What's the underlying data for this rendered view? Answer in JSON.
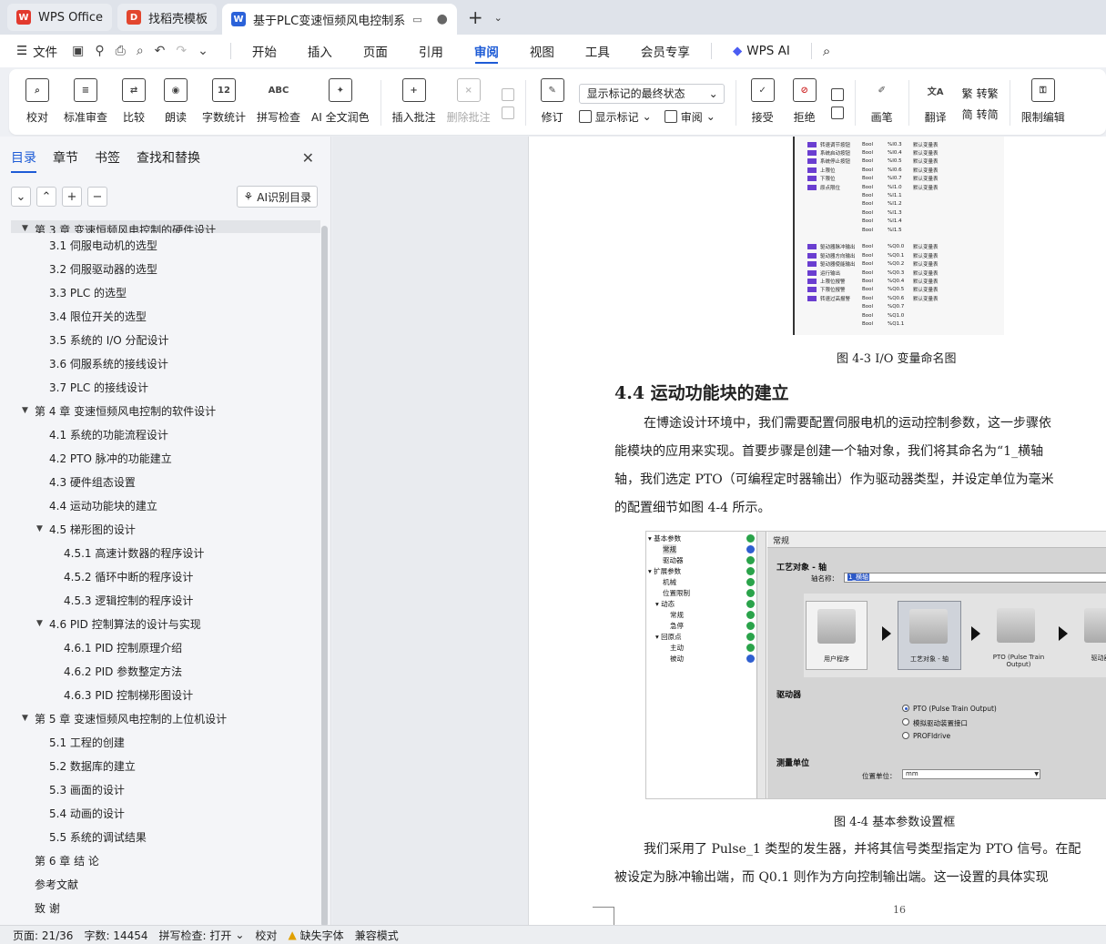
{
  "tabs": [
    {
      "label": "WPS Office",
      "icon": "wps-logo-icon"
    },
    {
      "label": "找稻壳模板",
      "icon": "daoke-logo-icon"
    },
    {
      "label": "基于PLC变速恒频风电控制系",
      "icon": "writer-logo-icon"
    }
  ],
  "menu": {
    "file": "文件",
    "items": [
      "开始",
      "插入",
      "页面",
      "引用",
      "审阅",
      "视图",
      "工具",
      "会员专享"
    ],
    "active": "审阅",
    "wps_ai": "WPS AI"
  },
  "ribbon": {
    "proofread": "校对",
    "standard_review": "标准审查",
    "compare": "比较",
    "read_aloud": "朗读",
    "word_count": "字数统计",
    "spell_check": "拼写检查",
    "ai_polish": "AI 全文润色",
    "insert_comment": "插入批注",
    "delete_comment": "删除批注",
    "track_changes": "修订",
    "markup_select": "显示标记的最终状态",
    "show_markup": "显示标记",
    "review_pane": "审阅",
    "accept": "接受",
    "reject": "拒绝",
    "pen": "画笔",
    "translate": "翻译",
    "to_traditional": "转繁",
    "to_simplified": "转简",
    "restrict_edit": "限制编辑"
  },
  "left_panel": {
    "tabs": [
      "目录",
      "章节",
      "书签",
      "查找和替换"
    ],
    "active_tab": "目录",
    "ai_toc": "AI识别目录",
    "toc": [
      {
        "text": "第 3 章  变速恒频风电控制的硬件设计",
        "level": 1,
        "arrow": "▼",
        "cut": true
      },
      {
        "text": "3.1  伺服电动机的选型",
        "level": 2
      },
      {
        "text": "3.2  伺服驱动器的选型",
        "level": 2
      },
      {
        "text": "3.3 PLC 的选型",
        "level": 2
      },
      {
        "text": "3.4  限位开关的选型",
        "level": 2
      },
      {
        "text": "3.5  系统的 I/O 分配设计",
        "level": 2
      },
      {
        "text": "3.6  伺服系统的接线设计",
        "level": 2
      },
      {
        "text": "3.7 PLC 的接线设计",
        "level": 2
      },
      {
        "text": "第 4 章  变速恒频风电控制的软件设计",
        "level": 1,
        "arrow": "▼"
      },
      {
        "text": "4.1  系统的功能流程设计",
        "level": 2
      },
      {
        "text": "4.2 PTO 脉冲的功能建立",
        "level": 2
      },
      {
        "text": "4.3  硬件组态设置",
        "level": 2
      },
      {
        "text": "4.4  运动功能块的建立",
        "level": 2
      },
      {
        "text": "4.5  梯形图的设计",
        "level": 2,
        "arrow": "▼"
      },
      {
        "text": "4.5.1  高速计数器的程序设计",
        "level": 3
      },
      {
        "text": "4.5.2  循环中断的程序设计",
        "level": 3
      },
      {
        "text": "4.5.3  逻辑控制的程序设计",
        "level": 3
      },
      {
        "text": "4.6 PID 控制算法的设计与实现",
        "level": 2,
        "arrow": "▼"
      },
      {
        "text": "4.6.1 PID 控制原理介绍",
        "level": 3
      },
      {
        "text": "4.6.2 PID 参数整定方法",
        "level": 3
      },
      {
        "text": "4.6.3 PID 控制梯形图设计",
        "level": 3
      },
      {
        "text": "第 5 章  变速恒频风电控制的上位机设计",
        "level": 1,
        "arrow": "▼"
      },
      {
        "text": "5.1  工程的创建",
        "level": 2
      },
      {
        "text": "5.2  数据库的建立",
        "level": 2
      },
      {
        "text": "5.3  画面的设计",
        "level": 2
      },
      {
        "text": "5.4  动画的设计",
        "level": 2
      },
      {
        "text": "5.5  系统的调试结果",
        "level": 2
      },
      {
        "text": "第 6 章  结    论",
        "level": 1
      },
      {
        "text": "参考文献",
        "level": 1
      },
      {
        "text": "致    谢",
        "level": 1
      }
    ]
  },
  "document": {
    "io_table": [
      {
        "tag": true,
        "name": "转速调节按钮",
        "type": "Bool",
        "addr": "%I0.3",
        "note": "默认变量表"
      },
      {
        "tag": true,
        "name": "系统启动按钮",
        "type": "Bool",
        "addr": "%I0.4",
        "note": "默认变量表"
      },
      {
        "tag": true,
        "name": "系统停止按钮",
        "type": "Bool",
        "addr": "%I0.5",
        "note": "默认变量表"
      },
      {
        "tag": true,
        "name": "上限位",
        "type": "Bool",
        "addr": "%I0.6",
        "note": "默认变量表"
      },
      {
        "tag": true,
        "name": "下限位",
        "type": "Bool",
        "addr": "%I0.7",
        "note": "默认变量表"
      },
      {
        "tag": true,
        "name": "原点限位",
        "type": "Bool",
        "addr": "%I1.0",
        "note": "默认变量表"
      },
      {
        "tag": false,
        "name": "",
        "type": "Bool",
        "addr": "%I1.1",
        "note": ""
      },
      {
        "tag": false,
        "name": "",
        "type": "Bool",
        "addr": "%I1.2",
        "note": ""
      },
      {
        "tag": false,
        "name": "",
        "type": "Bool",
        "addr": "%I1.3",
        "note": ""
      },
      {
        "tag": false,
        "name": "",
        "type": "Bool",
        "addr": "%I1.4",
        "note": ""
      },
      {
        "tag": false,
        "name": "",
        "type": "Bool",
        "addr": "%I1.5",
        "note": ""
      },
      {
        "tag": false,
        "name": "",
        "type": "",
        "addr": "",
        "note": ""
      },
      {
        "tag": true,
        "name": "驱动器脉冲输出",
        "type": "Bool",
        "addr": "%Q0.0",
        "note": "默认变量表"
      },
      {
        "tag": true,
        "name": "驱动器方向输出",
        "type": "Bool",
        "addr": "%Q0.1",
        "note": "默认变量表"
      },
      {
        "tag": true,
        "name": "驱动器使能输出",
        "type": "Bool",
        "addr": "%Q0.2",
        "note": "默认变量表"
      },
      {
        "tag": true,
        "name": "运行输出",
        "type": "Bool",
        "addr": "%Q0.3",
        "note": "默认变量表"
      },
      {
        "tag": true,
        "name": "上限位报警",
        "type": "Bool",
        "addr": "%Q0.4",
        "note": "默认变量表"
      },
      {
        "tag": true,
        "name": "下限位报警",
        "type": "Bool",
        "addr": "%Q0.5",
        "note": "默认变量表"
      },
      {
        "tag": true,
        "name": "转速过高报警",
        "type": "Bool",
        "addr": "%Q0.6",
        "note": "默认变量表"
      },
      {
        "tag": false,
        "name": "",
        "type": "Bool",
        "addr": "%Q0.7",
        "note": ""
      },
      {
        "tag": false,
        "name": "",
        "type": "Bool",
        "addr": "%Q1.0",
        "note": ""
      },
      {
        "tag": false,
        "name": "",
        "type": "Bool",
        "addr": "%Q1.1",
        "note": ""
      }
    ],
    "caption_43": "图 4-3 I/O 变量命名图",
    "heading_44": "4.4  运动功能块的建立",
    "para1": [
      "在博途设计环境中，我们需要配置伺服电机的运动控制参数，这一步骤依",
      "能模块的应用来实现。首要步骤是创建一个轴对象，我们将其命名为“1_横轴",
      "轴，我们选定 PTO（可编程定时器输出）作为驱动器类型，并设定单位为毫米",
      "的配置细节如图 4-4 所示。"
    ],
    "param_figure": {
      "tree": [
        {
          "text": "▾ 基本参数",
          "indent": 0,
          "check": "green"
        },
        {
          "text": "常规",
          "indent": 2,
          "check": "blue",
          "selected": true
        },
        {
          "text": "驱动器",
          "indent": 2,
          "check": "green"
        },
        {
          "text": "▾ 扩展参数",
          "indent": 0,
          "check": "green"
        },
        {
          "text": "机械",
          "indent": 2,
          "check": "green"
        },
        {
          "text": "位置限制",
          "indent": 2,
          "check": "green"
        },
        {
          "text": "▾ 动态",
          "indent": 1,
          "check": "green"
        },
        {
          "text": "常规",
          "indent": 3,
          "check": "green"
        },
        {
          "text": "急停",
          "indent": 3,
          "check": "green"
        },
        {
          "text": "▾ 回原点",
          "indent": 1,
          "check": "green"
        },
        {
          "text": "主动",
          "indent": 3,
          "check": "green"
        },
        {
          "text": "被动",
          "indent": 3,
          "check": "blue"
        }
      ],
      "header": "常规",
      "section_tech": "工艺对象 - 轴",
      "axis_name_label": "轴名称：",
      "axis_name_value": "1_横轴",
      "diagram": [
        "用户程序",
        "工艺对象 - 轴",
        "PTO (Pulse Train Output)",
        "驱动器"
      ],
      "section_drive": "驱动器",
      "drive_options": [
        "PTO (Pulse Train Output)",
        "模拟驱动装置接口",
        "PROFIdrive"
      ],
      "section_unit": "测量单位",
      "unit_label": "位置单位：",
      "unit_value": "mm"
    },
    "caption_44": "图 4-4  基本参数设置框",
    "para2": [
      "我们采用了 Pulse_1 类型的发生器，并将其信号类型指定为 PTO 信号。在配",
      "被设定为脉冲输出端，而 Q0.1 则作为方向控制输出端。这一设置的具体实现"
    ],
    "page_number": "16"
  },
  "status": {
    "page": "页面: 21/36",
    "words": "字数: 14454",
    "spell": "拼写检查: 打开",
    "proof": "校对",
    "missing_font": "缺失字体",
    "compat": "兼容模式"
  }
}
